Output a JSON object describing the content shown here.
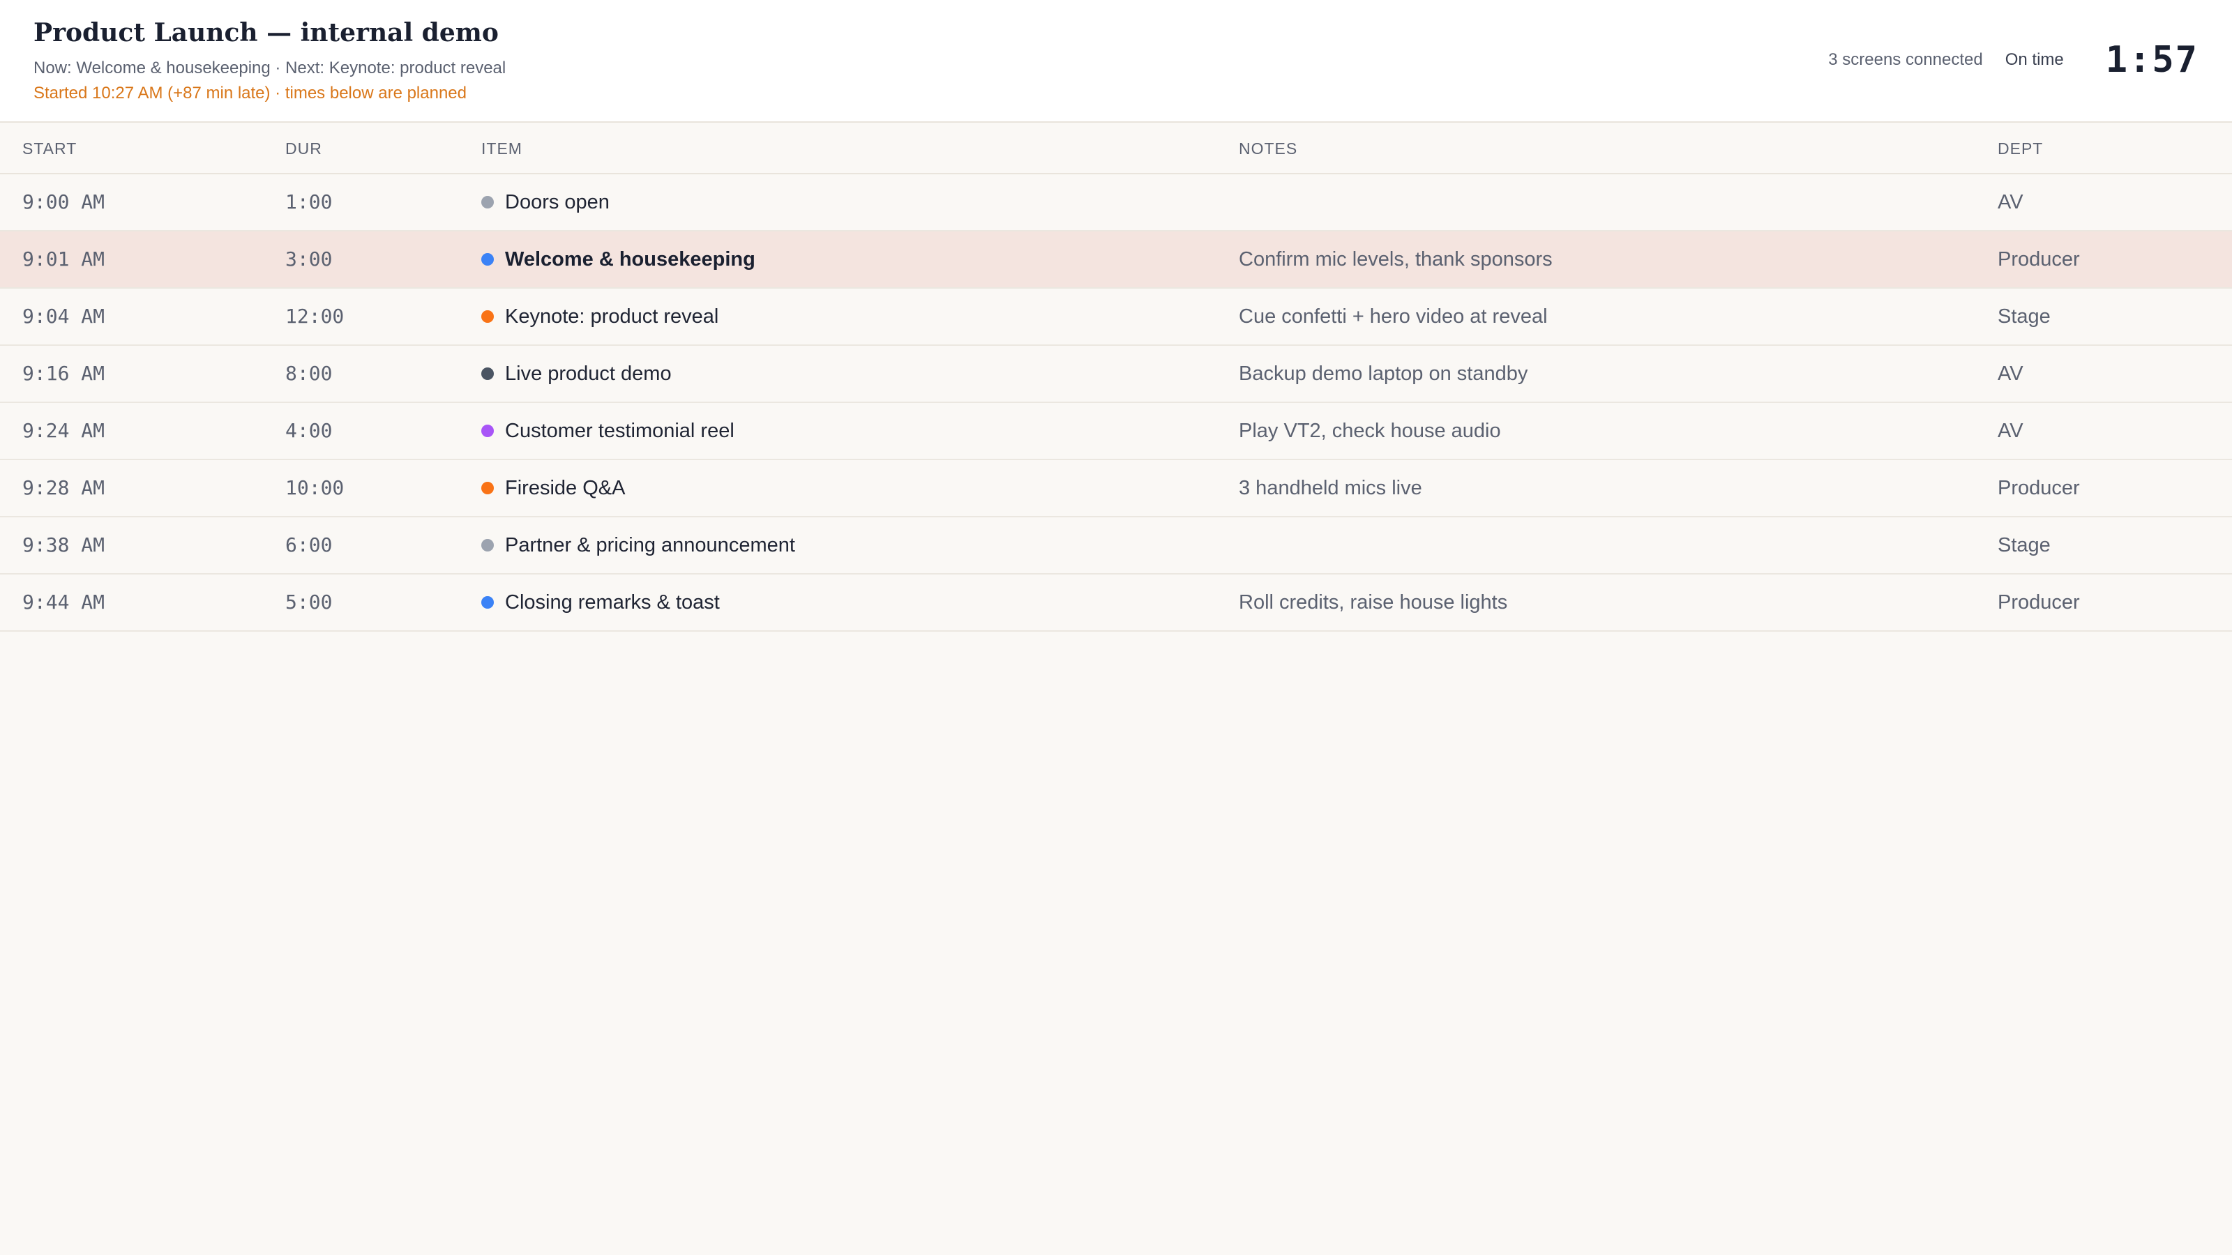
{
  "header": {
    "title": "Product Launch — internal demo",
    "now_next": "Now: Welcome & housekeeping · Next: Keynote: product reveal",
    "started": "Started 10:27 AM (+87 min late) · times below are planned",
    "screens": "3 screens connected",
    "on_time": "On time",
    "clock": "1:57"
  },
  "columns": {
    "start": "START",
    "dur": "DUR",
    "item": "ITEM",
    "notes": "NOTES",
    "dept": "DEPT"
  },
  "rows": [
    {
      "start": "9:00 AM",
      "dur": "1:00",
      "item": "Doors open",
      "notes": "",
      "dept": "AV",
      "color": "#9ca3af",
      "current": false
    },
    {
      "start": "9:01 AM",
      "dur": "3:00",
      "item": "Welcome & housekeeping",
      "notes": "Confirm mic levels, thank sponsors",
      "dept": "Producer",
      "color": "#3b82f6",
      "current": true
    },
    {
      "start": "9:04 AM",
      "dur": "12:00",
      "item": "Keynote: product reveal",
      "notes": "Cue confetti + hero video at reveal",
      "dept": "Stage",
      "color": "#f97316",
      "current": false
    },
    {
      "start": "9:16 AM",
      "dur": "8:00",
      "item": "Live product demo",
      "notes": "Backup demo laptop on standby",
      "dept": "AV",
      "color": "#4b5563",
      "current": false
    },
    {
      "start": "9:24 AM",
      "dur": "4:00",
      "item": "Customer testimonial reel",
      "notes": "Play VT2, check house audio",
      "dept": "AV",
      "color": "#a855f7",
      "current": false
    },
    {
      "start": "9:28 AM",
      "dur": "10:00",
      "item": "Fireside Q&A",
      "notes": "3 handheld mics live",
      "dept": "Producer",
      "color": "#f97316",
      "current": false
    },
    {
      "start": "9:38 AM",
      "dur": "6:00",
      "item": "Partner & pricing announcement",
      "notes": "",
      "dept": "Stage",
      "color": "#9ca3af",
      "current": false
    },
    {
      "start": "9:44 AM",
      "dur": "5:00",
      "item": "Closing remarks & toast",
      "notes": "Roll credits, raise house lights",
      "dept": "Producer",
      "color": "#3b82f6",
      "current": false
    }
  ]
}
